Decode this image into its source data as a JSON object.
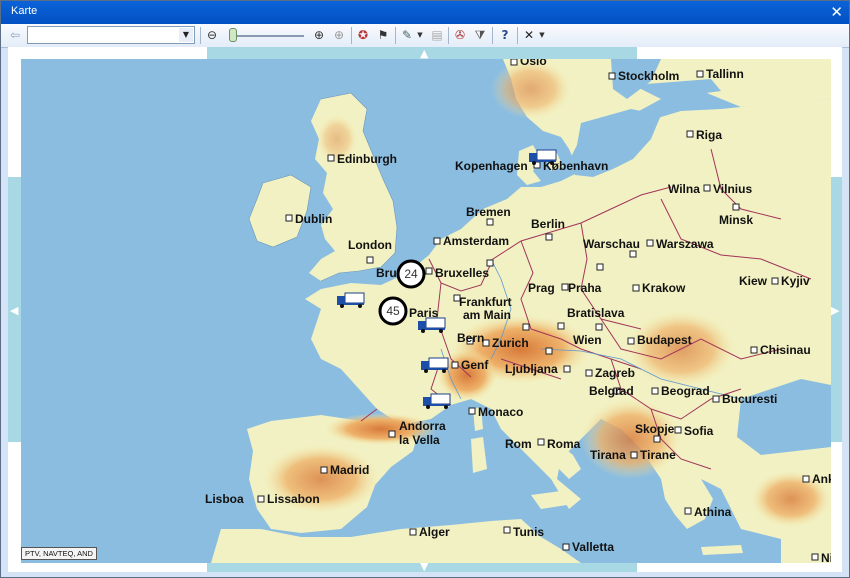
{
  "window": {
    "title": "Karte",
    "close_glyph": "✕"
  },
  "toolbar": {
    "back_icon": "back-arrow-icon",
    "search_value": "",
    "dropdown_glyph": "▼",
    "tools": [
      {
        "name": "zoom-out-icon",
        "glyph": "⊖"
      },
      {
        "name": "zoom-in-icon",
        "glyph": "⊕"
      },
      {
        "name": "zoom-extent-icon",
        "glyph": "⊕"
      },
      {
        "name": "route-icon",
        "glyph": "✪"
      },
      {
        "name": "checkered-flag-icon",
        "glyph": "⚑"
      },
      {
        "name": "edit-icon",
        "glyph": "✎"
      },
      {
        "name": "layers-icon",
        "glyph": "▤"
      },
      {
        "name": "compass-icon",
        "glyph": "✇"
      },
      {
        "name": "filter-icon",
        "glyph": "⧩"
      },
      {
        "name": "help-icon",
        "glyph": "?"
      },
      {
        "name": "delete-icon",
        "glyph": "✕"
      }
    ],
    "zoom_level": 0.1
  },
  "map": {
    "copyright": "PTV, NAVTEQ, AND",
    "cities": [
      {
        "id": "oslo",
        "label": "Oslo"
      },
      {
        "id": "stockholm",
        "label": "Stockholm"
      },
      {
        "id": "tallinn",
        "label": "Tallinn"
      },
      {
        "id": "riga",
        "label": "Riga"
      },
      {
        "id": "edinburgh",
        "label": "Edinburgh"
      },
      {
        "id": "kopenhagen",
        "label": "Kopenhagen"
      },
      {
        "id": "kobenhavn",
        "label": "København"
      },
      {
        "id": "wilna",
        "label": "Wilna"
      },
      {
        "id": "vilnius",
        "label": "Vilnius"
      },
      {
        "id": "minsk",
        "label": "Minsk"
      },
      {
        "id": "dublin",
        "label": "Dublin"
      },
      {
        "id": "bremen",
        "label": "Bremen"
      },
      {
        "id": "berlin",
        "label": "Berlin"
      },
      {
        "id": "london",
        "label": "London"
      },
      {
        "id": "amsterdam",
        "label": "Amsterdam"
      },
      {
        "id": "warschau",
        "label": "Warschau"
      },
      {
        "id": "warszawa",
        "label": "Warszawa"
      },
      {
        "id": "brussel",
        "label": "Bru"
      },
      {
        "id": "bruxelles",
        "label": "Bruxelles"
      },
      {
        "id": "kiew",
        "label": "Kiew"
      },
      {
        "id": "kyjiv",
        "label": "Kyjiv"
      },
      {
        "id": "prag",
        "label": "Prag"
      },
      {
        "id": "praha",
        "label": "Praha"
      },
      {
        "id": "krakow",
        "label": "Krakow"
      },
      {
        "id": "frankfurt",
        "label": "Frankfurt"
      },
      {
        "id": "frankfurt2",
        "label": "am Main"
      },
      {
        "id": "paris",
        "label": "Paris"
      },
      {
        "id": "bratislava",
        "label": "Bratislava"
      },
      {
        "id": "bern",
        "label": "Bern"
      },
      {
        "id": "zurich",
        "label": "Zurich"
      },
      {
        "id": "wien",
        "label": "Wien"
      },
      {
        "id": "budapest",
        "label": "Budapest"
      },
      {
        "id": "chisinau",
        "label": "Chisinau"
      },
      {
        "id": "genf",
        "label": "Genf"
      },
      {
        "id": "ljubljana",
        "label": "Ljubljana"
      },
      {
        "id": "zagreb",
        "label": "Zagreb"
      },
      {
        "id": "belgrad",
        "label": "Belgrad"
      },
      {
        "id": "beograd",
        "label": "Beograd"
      },
      {
        "id": "bucuresti",
        "label": "Bucuresti"
      },
      {
        "id": "monaco",
        "label": "Monaco"
      },
      {
        "id": "andorra",
        "label": "Andorra"
      },
      {
        "id": "andorra2",
        "label": "la Vella"
      },
      {
        "id": "skopje",
        "label": "Skopje"
      },
      {
        "id": "sofia",
        "label": "Sofia"
      },
      {
        "id": "rom",
        "label": "Rom"
      },
      {
        "id": "roma",
        "label": "Roma"
      },
      {
        "id": "madrid",
        "label": "Madrid"
      },
      {
        "id": "tirana",
        "label": "Tirana"
      },
      {
        "id": "tirane",
        "label": "Tirane"
      },
      {
        "id": "ank",
        "label": "Ank"
      },
      {
        "id": "lisboa",
        "label": "Lisboa"
      },
      {
        "id": "lissabon",
        "label": "Lissabon"
      },
      {
        "id": "athina",
        "label": "Athina"
      },
      {
        "id": "alger",
        "label": "Alger"
      },
      {
        "id": "tunis",
        "label": "Tunis"
      },
      {
        "id": "valletta",
        "label": "Valletta"
      },
      {
        "id": "ni",
        "label": "Ni"
      }
    ],
    "clusters": [
      {
        "id": "cluster-24",
        "count": "24"
      },
      {
        "id": "cluster-45",
        "count": "45"
      }
    ],
    "colors": {
      "sea": "#8bbde0",
      "land": "#f2f1c3",
      "mountain": "#e8a25a",
      "border": "#a2345a",
      "accent": "#0350c2"
    }
  }
}
